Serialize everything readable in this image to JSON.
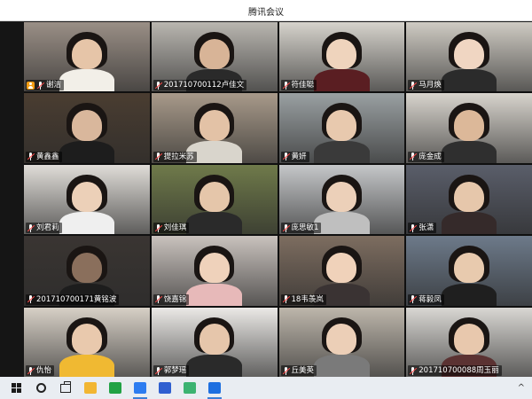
{
  "window": {
    "title": "腾讯会议"
  },
  "participants": [
    {
      "name": "谢洁",
      "host": true,
      "bg": "#9a8f86",
      "skin": "#e6c5a8",
      "body": "#f2efe8"
    },
    {
      "name": "201710700112卢佳文",
      "host": false,
      "bg": "#b9b6b0",
      "skin": "#d8b497",
      "body": "#2a2a2a"
    },
    {
      "name": "符佳聪",
      "host": false,
      "bg": "#d6d3cc",
      "skin": "#efd4bd",
      "body": "#5a1e22"
    },
    {
      "name": "马月焕",
      "host": false,
      "bg": "#cfcbc3",
      "skin": "#f0d6c2",
      "body": "#2b2b2b"
    },
    {
      "name": "黄鑫鑫",
      "host": false,
      "bg": "#4a3d31",
      "skin": "#d9b79c",
      "body": "#1d1d1d"
    },
    {
      "name": "提拉米苏",
      "host": false,
      "bg": "#a89a8a",
      "skin": "#e3c2a6",
      "body": "#d9d5cc"
    },
    {
      "name": "黄妍",
      "host": false,
      "bg": "#9aa0a2",
      "skin": "#e8c9ae",
      "body": "#3a3a3a"
    },
    {
      "name": "庞金成",
      "host": false,
      "bg": "#d8d4cd",
      "skin": "#dcb899",
      "body": "#2f2f2f"
    },
    {
      "name": "刘君莉",
      "host": false,
      "bg": "#e0ddd8",
      "skin": "#ecd0b8",
      "body": "#efefef"
    },
    {
      "name": "刘佳琪",
      "host": false,
      "bg": "#6f7a4a",
      "skin": "#e5c6aa",
      "body": "#2a2a2a"
    },
    {
      "name": "庞思敏1",
      "host": false,
      "bg": "#c5c7c9",
      "skin": "#ecd0b9",
      "body": "#bfbfbf"
    },
    {
      "name": "张潇",
      "host": false,
      "bg": "#5a5e6a",
      "skin": "#e6c7ab",
      "body": "#352a2a"
    },
    {
      "name": "201710700171黄铭波",
      "host": false,
      "bg": "#3a3532",
      "skin": "#8a6f5c",
      "body": "#1d1d1d"
    },
    {
      "name": "饶嘉锦",
      "host": false,
      "bg": "#c9c2bd",
      "skin": "#efd2bb",
      "body": "#e7b9b9"
    },
    {
      "name": "18韦羡岚",
      "host": false,
      "bg": "#7d6d60",
      "skin": "#f0d2ba",
      "body": "#3a3333"
    },
    {
      "name": "蒋毅凤",
      "host": false,
      "bg": "#6d7a8a",
      "skin": "#e8caae",
      "body": "#1f1f1f"
    },
    {
      "name": "仇怡",
      "host": false,
      "bg": "#d7d0c6",
      "skin": "#e9c9ad",
      "body": "#f0b932"
    },
    {
      "name": "郭梦瑶",
      "host": false,
      "bg": "#ebe9e6",
      "skin": "#e6c6ab",
      "body": "#2a2a2a"
    },
    {
      "name": "丘美英",
      "host": false,
      "bg": "#bdb6ab",
      "skin": "#eccfb7",
      "body": "#7a7a7a"
    },
    {
      "name": "201710700088周玉丽",
      "host": false,
      "bg": "#d9d7d3",
      "skin": "#e8c8ad",
      "body": "#5b3232"
    }
  ],
  "taskbar": {
    "apps": [
      {
        "name": "explorer",
        "color": "#f2b632"
      },
      {
        "name": "chat-app",
        "color": "#21a244"
      },
      {
        "name": "phone-app",
        "color": "#2d7cf0"
      },
      {
        "name": "wps-app",
        "color": "#2f5fd0"
      },
      {
        "name": "play-app",
        "color": "#3cb371"
      },
      {
        "name": "meeting-app",
        "color": "#1e6fe0"
      }
    ]
  }
}
